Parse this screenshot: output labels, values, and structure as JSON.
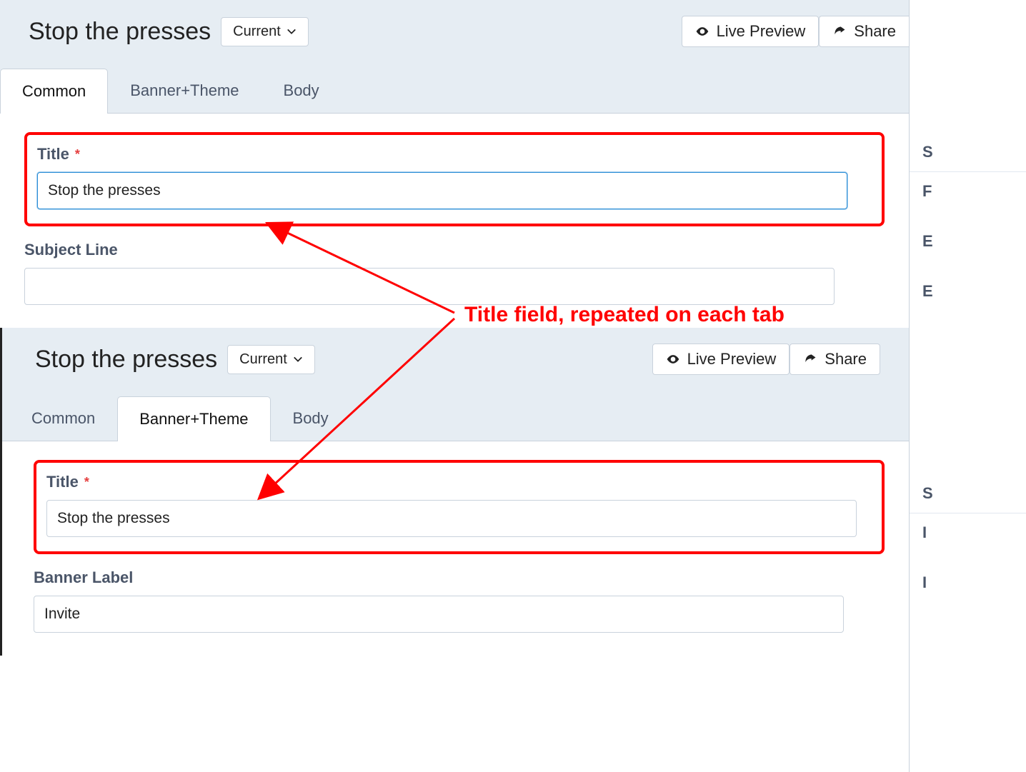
{
  "annotation": "Title field, repeated on each tab",
  "panels": [
    {
      "title": "Stop the presses",
      "version_label": "Current",
      "buttons": {
        "preview": "Live Preview",
        "share": "Share"
      },
      "tabs": [
        "Common",
        "Banner+Theme",
        "Body"
      ],
      "active_tab": 0,
      "fields": {
        "title_label": "Title",
        "title_value": "Stop the presses",
        "title_required": "*",
        "second_label": "Subject Line",
        "second_value": ""
      }
    },
    {
      "title": "Stop the presses",
      "version_label": "Current",
      "buttons": {
        "preview": "Live Preview",
        "share": "Share"
      },
      "tabs": [
        "Common",
        "Banner+Theme",
        "Body"
      ],
      "active_tab": 1,
      "fields": {
        "title_label": "Title",
        "title_value": "Stop the presses",
        "title_required": "*",
        "second_label": "Banner Label",
        "second_value": "Invite"
      }
    }
  ],
  "sidebar": {
    "top": [
      "S",
      "F",
      "E",
      "E"
    ],
    "bottom": [
      "S",
      "I",
      "I"
    ]
  }
}
